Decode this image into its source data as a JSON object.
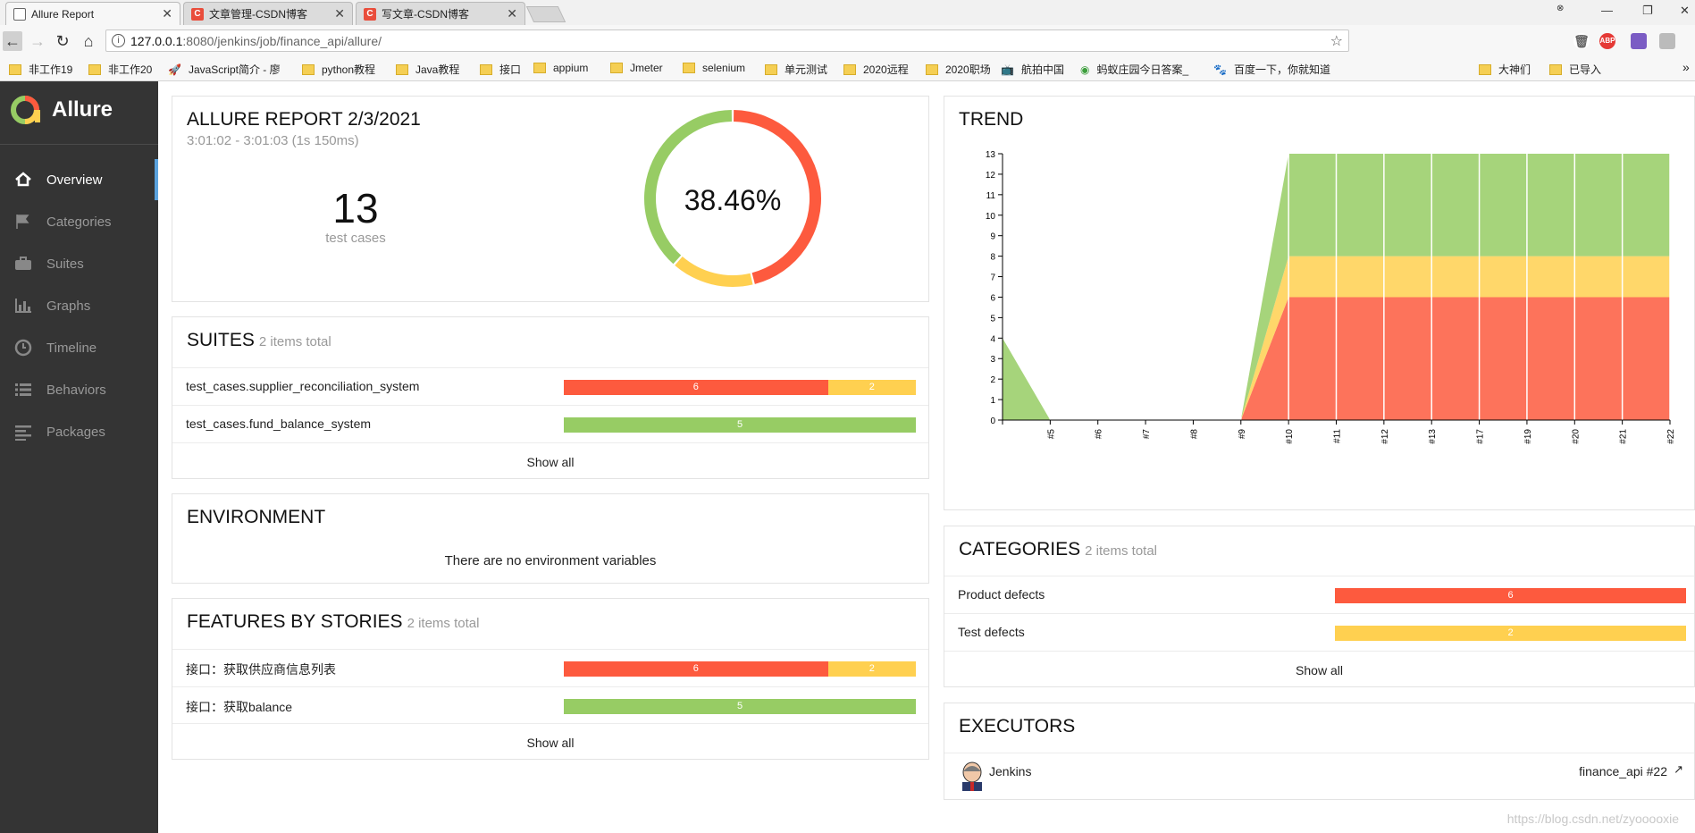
{
  "browser": {
    "tabs": [
      {
        "title": "Allure Report",
        "favicon": "allure-favicon",
        "active": true
      },
      {
        "title": "文章管理-CSDN博客",
        "favicon": "csdn-favicon",
        "active": false
      },
      {
        "title": "写文章-CSDN博客",
        "favicon": "csdn-favicon",
        "active": false
      }
    ],
    "url_host": "127.0.0.1",
    "url_path": ":8080/jenkins/job/finance_api/allure/",
    "bookmarks": [
      "非工作19",
      "非工作20",
      "JavaScript简介 - 廖",
      "python教程",
      "Java教程",
      "接口",
      "appium",
      "Jmeter",
      "selenium",
      "单元测试",
      "2020远程",
      "2020职场",
      "航拍中国",
      "蚂蚁庄园今日答案_",
      "百度一下，你就知道"
    ],
    "bookmarks_right": [
      "大神们",
      "已导入"
    ],
    "ext_abp": "ABP",
    "more": "»"
  },
  "sidebar": {
    "brand": "Allure",
    "items": [
      {
        "label": "Overview",
        "icon": "home-icon",
        "active": true
      },
      {
        "label": "Categories",
        "icon": "flag-icon",
        "active": false
      },
      {
        "label": "Suites",
        "icon": "briefcase-icon",
        "active": false
      },
      {
        "label": "Graphs",
        "icon": "bar-chart-icon",
        "active": false
      },
      {
        "label": "Timeline",
        "icon": "clock-icon",
        "active": false
      },
      {
        "label": "Behaviors",
        "icon": "list-icon",
        "active": false
      },
      {
        "label": "Packages",
        "icon": "align-left-icon",
        "active": false
      }
    ]
  },
  "summary": {
    "title": "ALLURE REPORT 2/3/2021",
    "time": "3:01:02 - 3:01:03 (1s 150ms)",
    "count": "13",
    "count_label": "test cases",
    "percent": "38.46%",
    "donut": [
      {
        "status": "failed",
        "value": 6,
        "color": "#fd5a3e"
      },
      {
        "status": "broken",
        "value": 2,
        "color": "#ffd050"
      },
      {
        "status": "passed",
        "value": 5,
        "color": "#97cc64"
      }
    ]
  },
  "suites": {
    "title": "SUITES",
    "subtitle": "2 items total",
    "rows": [
      {
        "name": "test_cases.supplier_reconciliation_system",
        "segments": [
          {
            "value": 6,
            "label": "6",
            "color": "#fd5a3e"
          },
          {
            "value": 2,
            "label": "2",
            "color": "#ffd050"
          }
        ]
      },
      {
        "name": "test_cases.fund_balance_system",
        "segments": [
          {
            "value": 5,
            "label": "5",
            "color": "#97cc64"
          }
        ]
      }
    ],
    "show_all": "Show all"
  },
  "environment": {
    "title": "ENVIRONMENT",
    "empty": "There are no environment variables"
  },
  "features": {
    "title": "FEATURES BY STORIES",
    "subtitle": "2 items total",
    "rows": [
      {
        "name": "接口：获取供应商信息列表",
        "segments": [
          {
            "value": 6,
            "label": "6",
            "color": "#fd5a3e"
          },
          {
            "value": 2,
            "label": "2",
            "color": "#ffd050"
          }
        ]
      },
      {
        "name": "接口：获取balance",
        "segments": [
          {
            "value": 5,
            "label": "5",
            "color": "#97cc64"
          }
        ]
      }
    ],
    "show_all": "Show all"
  },
  "trend": {
    "title": "TREND"
  },
  "chart_data": {
    "type": "area",
    "title": "TREND",
    "x": [
      "",
      "#5",
      "#6",
      "#7",
      "#8",
      "#9",
      "#10",
      "#11",
      "#12",
      "#13",
      "#17",
      "#19",
      "#20",
      "#21",
      "#22"
    ],
    "yticks": [
      "0",
      "1",
      "2",
      "3",
      "4",
      "5",
      "6",
      "7",
      "8",
      "9",
      "10",
      "11",
      "12",
      "13"
    ],
    "ylim": [
      0,
      13
    ],
    "series": [
      {
        "name": "failed",
        "color": "#fd5a3e",
        "values": [
          0,
          0,
          0,
          0,
          0,
          0,
          6,
          6,
          6,
          6,
          6,
          6,
          6,
          6,
          6
        ]
      },
      {
        "name": "broken",
        "color": "#ffd050",
        "values": [
          0,
          0,
          0,
          0,
          0,
          0,
          2,
          2,
          2,
          2,
          2,
          2,
          2,
          2,
          2
        ]
      },
      {
        "name": "passed",
        "color": "#97cc64",
        "values": [
          4,
          0,
          0,
          0,
          0,
          0,
          5,
          5,
          5,
          5,
          5,
          5,
          5,
          5,
          5
        ]
      }
    ]
  },
  "categories": {
    "title": "CATEGORIES",
    "subtitle": "2 items total",
    "rows": [
      {
        "name": "Product defects",
        "segments": [
          {
            "value": 6,
            "label": "6",
            "color": "#fd5a3e"
          }
        ]
      },
      {
        "name": "Test defects",
        "segments": [
          {
            "value": 2,
            "label": "2",
            "color": "#ffd050"
          }
        ]
      }
    ],
    "show_all": "Show all"
  },
  "executors": {
    "title": "EXECUTORS",
    "name": "Jenkins",
    "build": "finance_api #22"
  },
  "watermark": "https://blog.csdn.net/zyooooxie"
}
